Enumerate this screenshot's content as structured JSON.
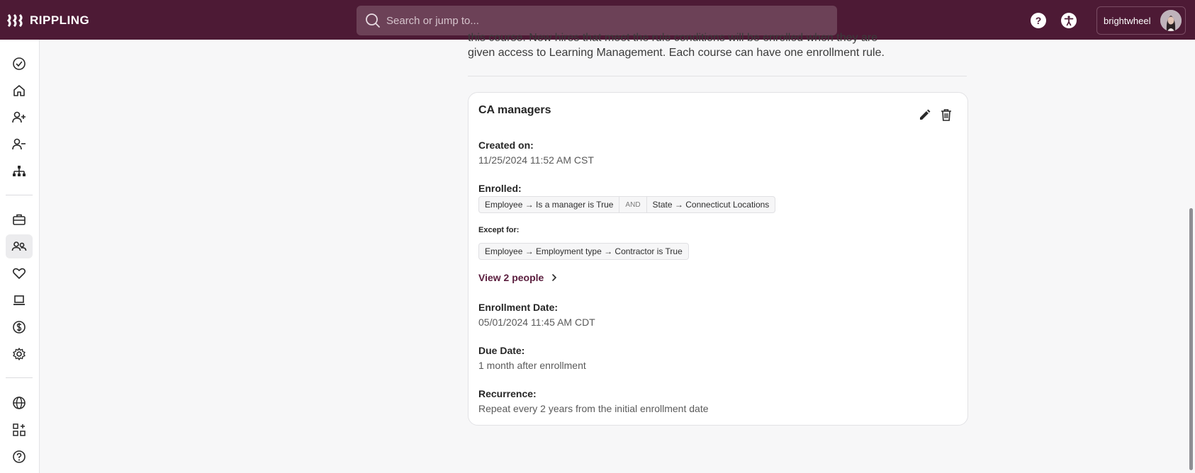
{
  "topbar": {
    "brand": "RIPPLING",
    "search_placeholder": "Search or jump to...",
    "help_icon": "?",
    "account_name": "brightwheel"
  },
  "sidebar": {
    "items": [
      {
        "icon": "check-circle-icon",
        "active": false
      },
      {
        "icon": "home-icon",
        "active": false
      },
      {
        "icon": "add-person-icon",
        "active": false
      },
      {
        "icon": "remove-person-icon",
        "active": false
      },
      {
        "icon": "org-chart-icon",
        "active": false
      },
      {
        "icon": "briefcase-icon",
        "active": false
      },
      {
        "icon": "people-icon",
        "active": true
      },
      {
        "icon": "heart-icon",
        "active": false
      },
      {
        "icon": "laptop-icon",
        "active": false
      },
      {
        "icon": "dollar-icon",
        "active": false
      },
      {
        "icon": "settings-icon",
        "active": false
      },
      {
        "icon": "globe-icon",
        "active": false
      },
      {
        "icon": "apps-add-icon",
        "active": false
      },
      {
        "icon": "help-icon",
        "active": false
      }
    ]
  },
  "main": {
    "intro_line_1": "this course. New hires that meet the rule conditions will be enrolled when they are",
    "intro_line_2": "given access to Learning Management. Each course can have one enrollment rule."
  },
  "rule": {
    "title": "CA managers",
    "created_label": "Created on:",
    "created_value": "11/25/2024 11:52 AM CST",
    "enrolled_label": "Enrolled:",
    "enrolled_conditions": [
      "Employee → Is a manager is True",
      "State → Connecticut Locations"
    ],
    "enrolled_operator": "AND",
    "except_label": "Except for:",
    "except_conditions": [
      "Employee → Employment type → Contractor is True"
    ],
    "view_people": "View 2 people",
    "enrollment_date_label": "Enrollment Date:",
    "enrollment_date_value": "05/01/2024 11:45 AM CDT",
    "due_date_label": "Due Date:",
    "due_date_value": "1 month after enrollment",
    "recurrence_label": "Recurrence:",
    "recurrence_value": "Repeat every 2 years from the initial enrollment date"
  },
  "colors": {
    "topbar": "#4d1a35",
    "link": "#5a1d3d"
  }
}
